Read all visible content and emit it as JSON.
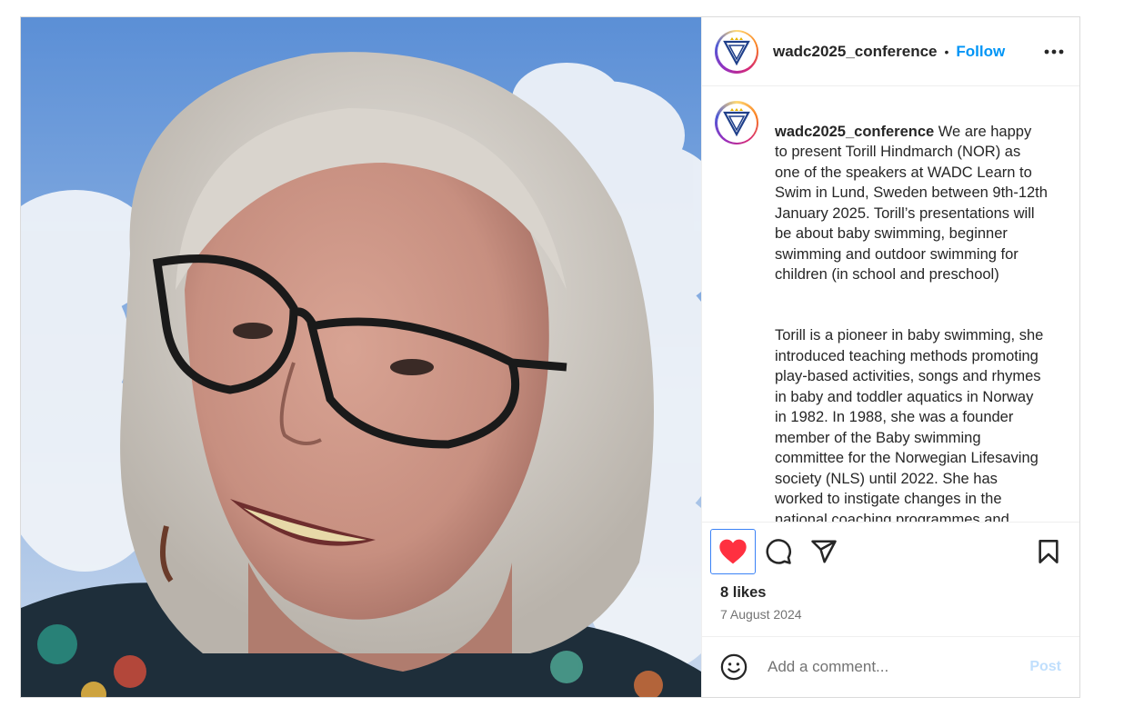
{
  "header": {
    "username": "wadc2025_conference",
    "separator": "•",
    "follow_label": "Follow",
    "more_icon": "more-horizontal-icon"
  },
  "caption": {
    "username": "wadc2025_conference",
    "paragraph1": "We are happy to present Torill Hindmarch (NOR) as one of the speakers at WADC Learn to Swim in Lund, Sweden between 9th-12th January 2025. Torill’s presentations will be about baby swimming, beginner swimming and outdoor swimming for children (in school and preschool)",
    "paragraph2": "Torill is a pioneer in baby swimming, she introduced teaching methods promoting play-based activities, songs and rhymes in baby and toddler aquatics in Norway in 1982. In 1988, she was a founder member of the Baby swimming committee for the Norwegian Lifesaving society (NLS) until 2022. She has worked to instigate changes in the national coaching programmes and children"
  },
  "actions": {
    "like_icon": "heart-filled-icon",
    "comment_icon": "comment-icon",
    "share_icon": "share-icon",
    "save_icon": "bookmark-icon",
    "like_color": "#ff3040"
  },
  "stats": {
    "likes": "8 likes",
    "date": "7 August 2024"
  },
  "comment": {
    "emoji_icon": "emoji-icon",
    "placeholder": "Add a comment...",
    "post_label": "Post"
  },
  "colors": {
    "accent": "#0095f6",
    "post_disabled": "#c0dffd"
  }
}
